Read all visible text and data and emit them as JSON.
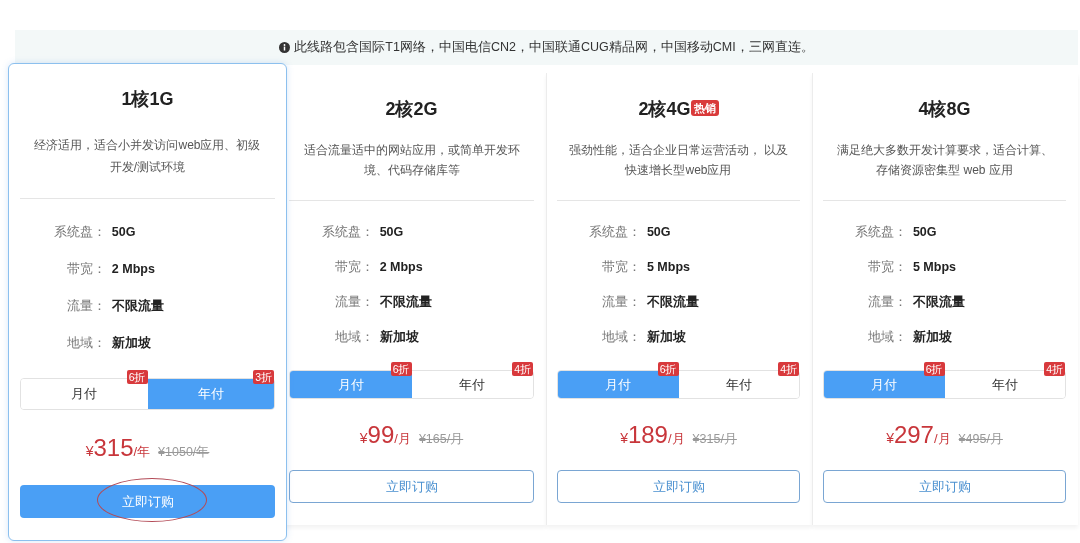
{
  "notice": {
    "text": "此线路包含国际T1网络，中国电信CN2，中国联通CUG精品网，中国移动CMI，三网直连。"
  },
  "plans": [
    {
      "title": "1核1G",
      "highlighted": true,
      "description": "经济适用，适合小并发访问web应用、初级开发/测试环境",
      "specs": [
        {
          "label": "系统盘：",
          "value": "50G"
        },
        {
          "label": "带宽：",
          "value": "2 Mbps"
        },
        {
          "label": "流量：",
          "value": "不限流量"
        },
        {
          "label": "地域：",
          "value": "新加坡"
        }
      ],
      "billing": [
        {
          "label": "月付",
          "discount": "6折",
          "selected": false
        },
        {
          "label": "年付",
          "discount": "3折",
          "selected": true
        }
      ],
      "currency": "¥",
      "price": "315",
      "unit": "/年",
      "original_price": "¥1050/年",
      "order_button": {
        "label": "立即订购",
        "circled": true
      }
    },
    {
      "title": "2核2G",
      "highlighted": false,
      "description": "适合流量适中的网站应用，或简单开发环境、代码存储库等",
      "specs": [
        {
          "label": "系统盘：",
          "value": "50G"
        },
        {
          "label": "带宽：",
          "value": "2 Mbps"
        },
        {
          "label": "流量：",
          "value": "不限流量"
        },
        {
          "label": "地域：",
          "value": "新加坡"
        }
      ],
      "billing": [
        {
          "label": "月付",
          "discount": "6折",
          "selected": true
        },
        {
          "label": "年付",
          "discount": "4折",
          "selected": false
        }
      ],
      "currency": "¥",
      "price": "99",
      "unit": "/月",
      "original_price": "¥165/月",
      "order_button": {
        "label": "立即订购",
        "circled": false
      }
    },
    {
      "title": "2核4G",
      "tag": "热销",
      "highlighted": false,
      "description": "强劲性能，适合企业日常运营活动， 以及快速增长型web应用",
      "specs": [
        {
          "label": "系统盘：",
          "value": "50G"
        },
        {
          "label": "带宽：",
          "value": "5 Mbps"
        },
        {
          "label": "流量：",
          "value": "不限流量"
        },
        {
          "label": "地域：",
          "value": "新加坡"
        }
      ],
      "billing": [
        {
          "label": "月付",
          "discount": "6折",
          "selected": true
        },
        {
          "label": "年付",
          "discount": "4折",
          "selected": false
        }
      ],
      "currency": "¥",
      "price": "189",
      "unit": "/月",
      "original_price": "¥315/月",
      "order_button": {
        "label": "立即订购",
        "circled": false
      }
    },
    {
      "title": "4核8G",
      "highlighted": false,
      "description": "满足绝大多数开发计算要求，适合计算、存储资源密集型 web 应用",
      "specs": [
        {
          "label": "系统盘：",
          "value": "50G"
        },
        {
          "label": "带宽：",
          "value": "5 Mbps"
        },
        {
          "label": "流量：",
          "value": "不限流量"
        },
        {
          "label": "地域：",
          "value": "新加坡"
        }
      ],
      "billing": [
        {
          "label": "月付",
          "discount": "6折",
          "selected": true
        },
        {
          "label": "年付",
          "discount": "4折",
          "selected": false
        }
      ],
      "currency": "¥",
      "price": "297",
      "unit": "/月",
      "original_price": "¥495/月",
      "order_button": {
        "label": "立即订购",
        "circled": false
      }
    }
  ]
}
